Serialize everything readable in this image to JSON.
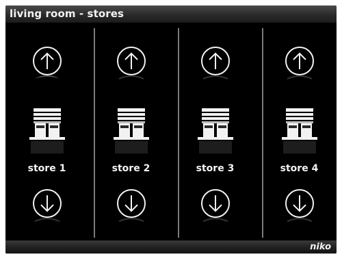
{
  "title_bar": {
    "title": "living room - stores"
  },
  "stores": [
    {
      "label": "store 1"
    },
    {
      "label": "store 2"
    },
    {
      "label": "store 3"
    },
    {
      "label": "store 4"
    }
  ],
  "icons": {
    "up": "arrow-up-circle-icon",
    "down": "arrow-down-circle-icon",
    "store": "window-blind-icon"
  },
  "footer": {
    "brand": "niko"
  },
  "colors": {
    "background": "#000000",
    "foreground": "#f2f2f2",
    "divider": "#8a8a8a"
  }
}
